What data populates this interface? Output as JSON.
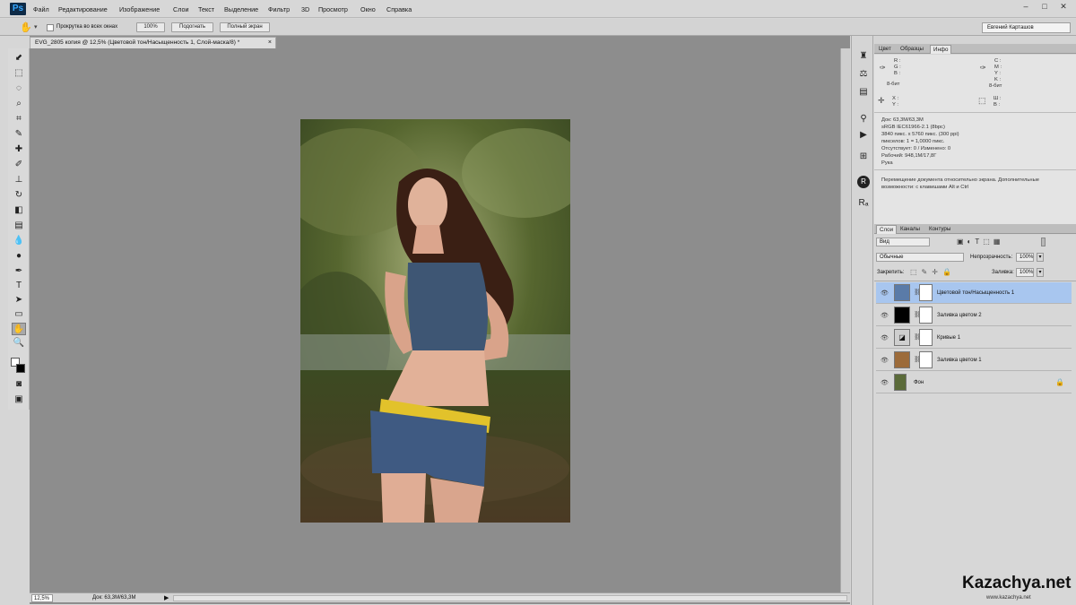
{
  "app": {
    "logo": "Ps"
  },
  "menu": [
    "Файл",
    "Редактирование",
    "Изображение",
    "Слои",
    "Текст",
    "Выделение",
    "Фильтр",
    "3D",
    "Просмотр",
    "Окно",
    "Справка"
  ],
  "window_controls": [
    "–",
    "□",
    "✕"
  ],
  "options": {
    "scroll_all_checkbox": "Прокрутка во всех окнах",
    "btn_100": "100%",
    "btn_fit": "Подогнать",
    "btn_fullscreen": "Полный экран",
    "user": "Евгений Карташов"
  },
  "document": {
    "tab_title": "EVG_2805 копия @ 12,5% (Цветовой тон/Насыщенность 1, Слой-маска/8) *",
    "close": "×",
    "zoom": "12,5%",
    "doc_size": "Док: 63,3M/63,3M"
  },
  "info_panel": {
    "tabs": [
      "Цвет",
      "Образцы",
      "Инфо"
    ],
    "left_channels": "R :\nG :\nB :",
    "right_channels": "C :\nM :\nY :\nK :",
    "bit_left": "8-бит",
    "bit_right": "8-бит",
    "xy_left": "X :\nY :",
    "wh_right": "Ш :\nВ :",
    "lines": [
      "Док: 63,3M/63,3M",
      "sRGB IEC61966-2.1 (8bpc)",
      "3840 пикс. x 5760 пикс. (300 ppi)",
      "пикселов: 1 = 1,0000 пикс.",
      "Отсутствует: 0 / Изменено: 0",
      "Рабочий: 948,1M/17,8Г",
      "Рука"
    ],
    "hint": "Перемещение документа относительно экрана. Дополнительные возможности: с клавишами Alt и Ctrl"
  },
  "layers_panel": {
    "tabs": [
      "Слои",
      "Каналы",
      "Контуры"
    ],
    "filter_kind": "Вид",
    "blend_mode": "Обычные",
    "opacity_label": "Непрозрачность:",
    "opacity_value": "100%",
    "lock_label": "Закрепить:",
    "fill_label": "Заливка:",
    "fill_value": "100%",
    "layers": [
      {
        "name": "Цветовой тон/Насыщенность 1",
        "thumb_color": "#5a7ba8",
        "selected": true,
        "mask": true
      },
      {
        "name": "Заливка цветом 2",
        "thumb_color": "#000000",
        "selected": false,
        "mask": true
      },
      {
        "name": "Кривые 1",
        "thumb_color": "#cfcfcf",
        "selected": false,
        "mask": true
      },
      {
        "name": "Заливка цветом 1",
        "thumb_color": "#9c6b3a",
        "selected": false,
        "mask": true
      },
      {
        "name": "Фон",
        "thumb_color": "#5b6b3a",
        "selected": false,
        "mask": false
      }
    ]
  },
  "watermark": "Kazachya.net",
  "watermark_sub": "www.kazachya.net",
  "colors": {
    "ui_bg": "#d6d6d6",
    "canvas_bg": "#8d8d8d",
    "selection": "#a8c6ef",
    "ps_blue": "#38a8ff"
  },
  "icons": {
    "toolbox": [
      "move-icon",
      "marquee-icon",
      "lasso-icon",
      "quick-select-icon",
      "crop-icon",
      "eyedropper-icon",
      "healing-brush-icon",
      "brush-icon",
      "clone-stamp-icon",
      "history-brush-icon",
      "eraser-icon",
      "gradient-icon",
      "blur-icon",
      "dodge-icon",
      "pen-icon",
      "type-icon",
      "path-select-icon",
      "shape-icon",
      "hand-icon",
      "zoom-icon",
      "color-swatches-icon",
      "quick-mask-icon",
      "screen-mode-icon"
    ]
  }
}
